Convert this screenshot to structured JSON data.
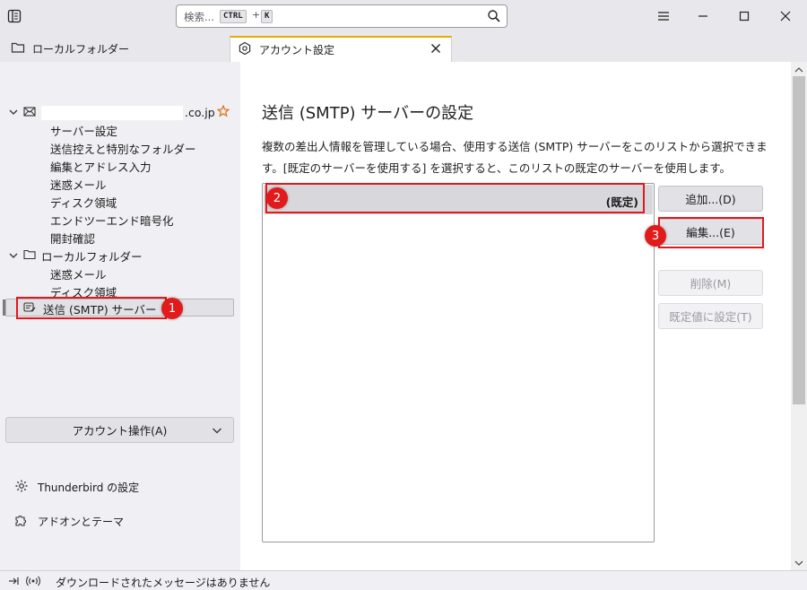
{
  "titlebar": {
    "search_placeholder": "検索...",
    "shortcut_ctrl": "CTRL",
    "shortcut_plus": "+",
    "shortcut_key": "K"
  },
  "tabs": [
    {
      "label": "ローカルフォルダー"
    },
    {
      "label": "アカウント設定"
    }
  ],
  "sidebar": {
    "account_domain": ".co.jp",
    "account_items": [
      "サーバー設定",
      "送信控えと特別なフォルダー",
      "編集とアドレス入力",
      "迷惑メール",
      "ディスク領域",
      "エンドツーエンド暗号化",
      "開封確認"
    ],
    "local_folder_label": "ローカルフォルダー",
    "local_items": [
      "迷惑メール",
      "ディスク領域"
    ],
    "smtp_label": "送信 (SMTP) サーバー",
    "account_actions_label": "アカウント操作(A)",
    "thunderbird_settings_label": "Thunderbird の設定",
    "addons_label": "アドオンとテーマ"
  },
  "main": {
    "heading": "送信 (SMTP) サーバーの設定",
    "description": "複数の差出人情報を管理している場合、使用する送信 (SMTP) サーバーをこのリストから選択できます。[既定のサーバーを使用する] を選択すると、このリストの既定のサーバーを使用します。",
    "server_list": [
      {
        "name": "",
        "tag": "(既定)"
      }
    ],
    "buttons": {
      "add": "追加...(D)",
      "edit": "編集...(E)",
      "delete": "削除(M)",
      "set_default": "既定値に設定(T)"
    }
  },
  "annotations": {
    "badge1": "1",
    "badge2": "2",
    "badge3": "3",
    "color": "#e3171d"
  },
  "status": {
    "message": "ダウンロードされたメッセージはありません"
  },
  "colors": {
    "active_tab_accent": "#e8a900",
    "annotation_red": "#e3171d",
    "sidebar_bg": "#f0f0f4",
    "titlebar_bg": "#e8e8ec"
  }
}
